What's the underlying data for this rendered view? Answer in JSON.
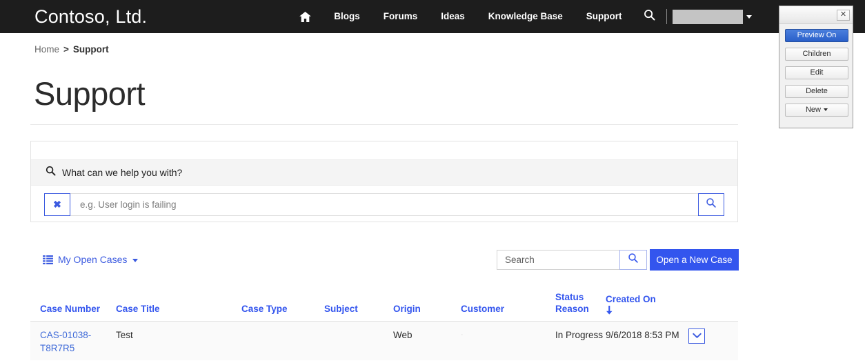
{
  "navbar": {
    "brand": "Contoso, Ltd.",
    "home_icon": "home-icon",
    "search_icon": "search-icon",
    "account_caret_icon": "chevron-down-icon",
    "items": [
      {
        "label": "Blogs"
      },
      {
        "label": "Forums"
      },
      {
        "label": "Ideas"
      },
      {
        "label": "Knowledge Base"
      },
      {
        "label": "Support"
      }
    ],
    "account_name": ""
  },
  "breadcrumb": {
    "home": "Home",
    "separator": ">",
    "current": "Support"
  },
  "page": {
    "title": "Support"
  },
  "help_search": {
    "heading": "What can we help you with?",
    "heading_icon": "search-icon",
    "clear_label": "✖",
    "clear_icon": "clear-x-icon",
    "input_value": "",
    "input_placeholder": "e.g. User login is failing",
    "submit_icon": "search-icon"
  },
  "toolbar": {
    "view_label": "My Open Cases",
    "view_icon": "list-icon",
    "view_caret_icon": "caret-down-icon",
    "grid_search_value": "",
    "grid_search_placeholder": "Search",
    "grid_search_icon": "search-icon",
    "new_case_label": "Open a New Case"
  },
  "grid": {
    "columns": [
      {
        "label": "Case Number"
      },
      {
        "label": "Case Title"
      },
      {
        "label": "Case Type"
      },
      {
        "label": "Subject"
      },
      {
        "label": "Origin"
      },
      {
        "label": "Customer"
      },
      {
        "label": "Status\nReason"
      },
      {
        "label": "Created On"
      }
    ],
    "sort_column": "Created On",
    "sort_direction_icon": "arrow-down-icon",
    "rows": [
      {
        "case_number": "CAS-01038-T8R7R5",
        "case_title": "Test",
        "case_type": "",
        "subject": "",
        "origin": "Web",
        "customer": "·",
        "status_reason": "In Progress",
        "created_on": "9/6/2018 8:53 PM",
        "row_menu_icon": "chevron-down-icon"
      }
    ]
  },
  "edit_panel": {
    "close_label": "✕",
    "close_icon": "close-icon",
    "buttons": [
      {
        "label": "Preview On",
        "active": true
      },
      {
        "label": "Children",
        "active": false
      },
      {
        "label": "Edit",
        "active": false
      },
      {
        "label": "Delete",
        "active": false
      }
    ],
    "new_label": "New",
    "new_caret_icon": "caret-down-icon"
  },
  "colors": {
    "navbar_bg": "#1d1d1d",
    "accent_blue": "#3355ee",
    "link_blue": "#3f6ad8",
    "panel_active_blue": "#2a5fc9",
    "row_bg": "#fafafa"
  }
}
